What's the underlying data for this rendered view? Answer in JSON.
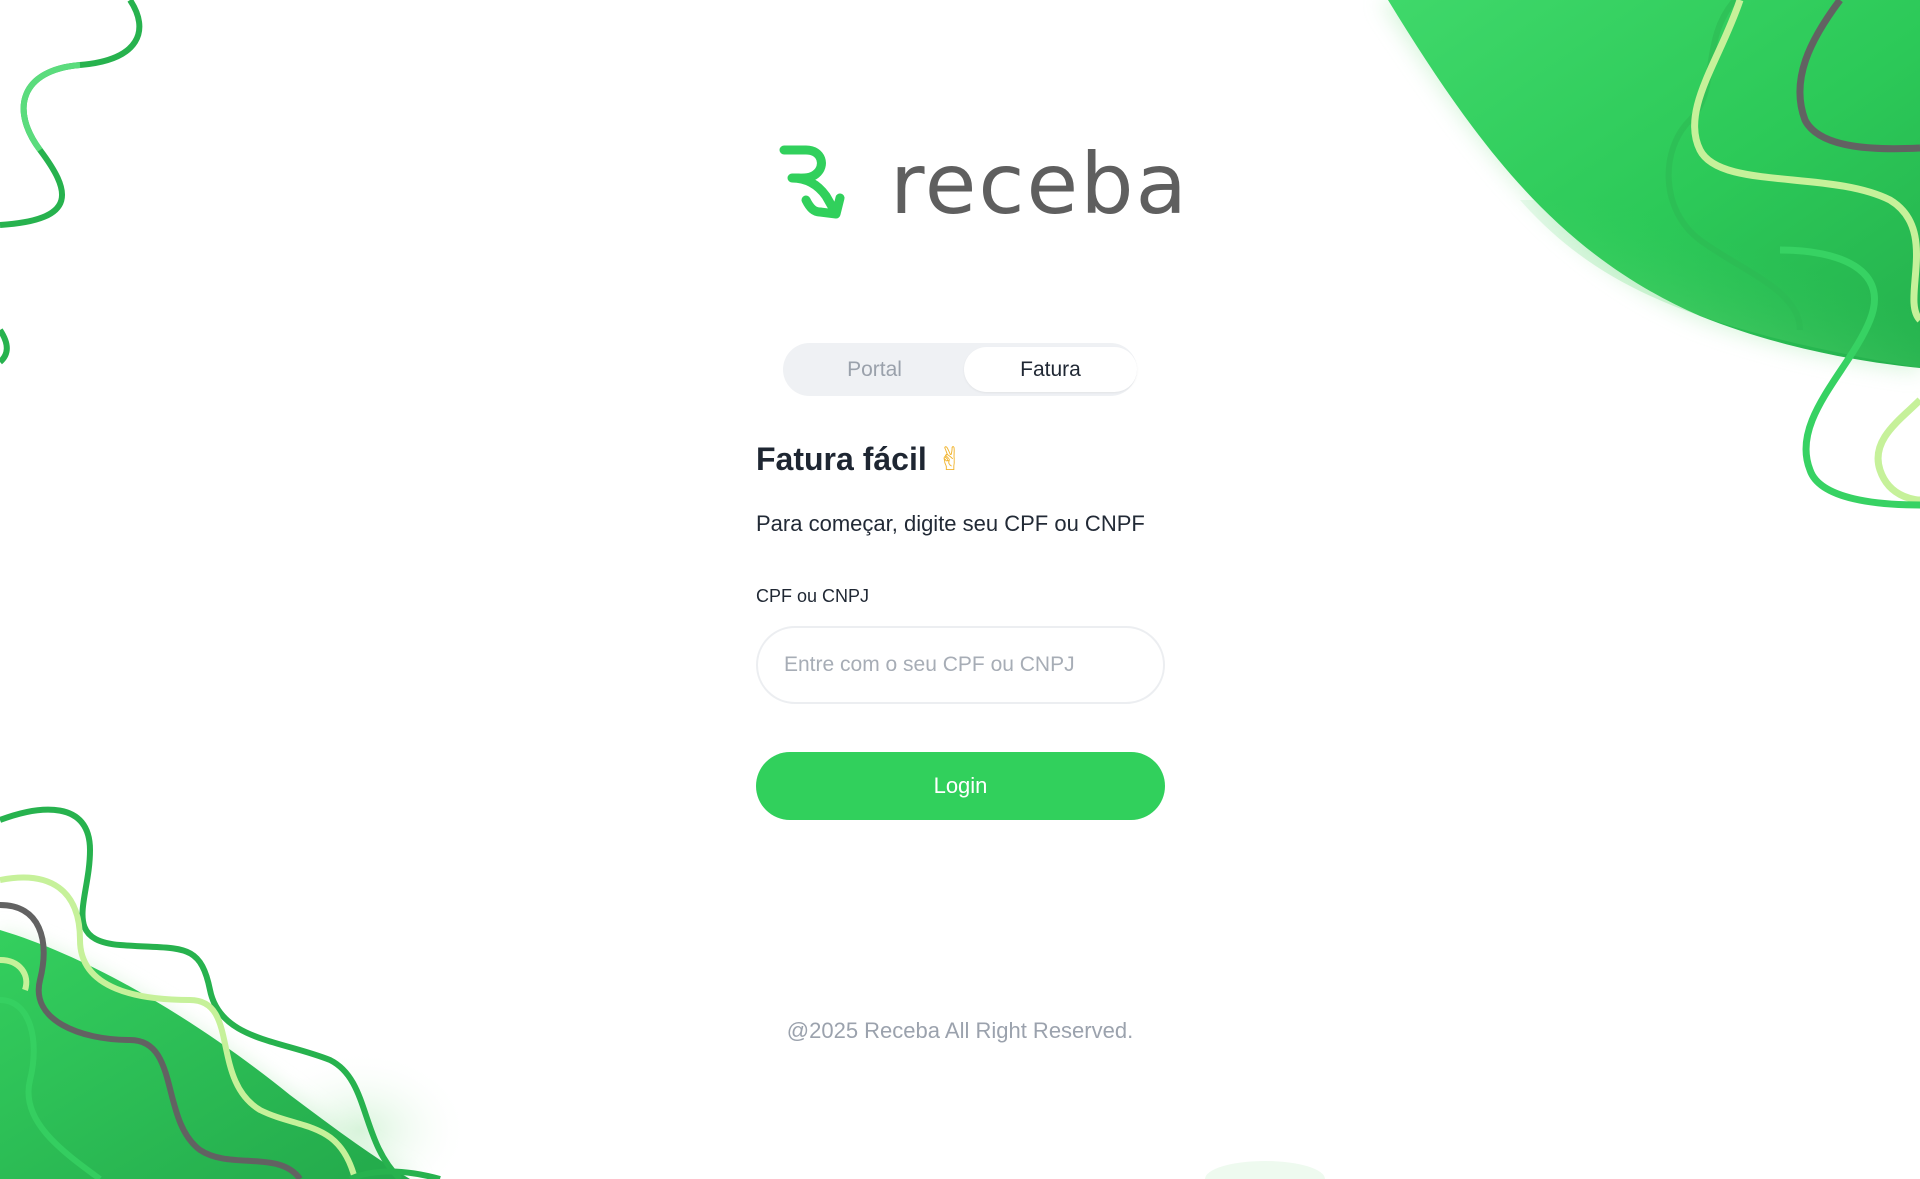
{
  "brand": {
    "name": "receba",
    "logo_icon": "arrow-r-icon",
    "colors": {
      "accent": "#31d05c",
      "wordmark": "#5f5f5f",
      "light_green": "#c6f19a",
      "dark_green": "#1ea34a",
      "gray_line": "#626262"
    }
  },
  "tabs": [
    {
      "label": "Portal",
      "active": false
    },
    {
      "label": "Fatura",
      "active": true
    }
  ],
  "form": {
    "title": "Fatura fácil",
    "title_emoji": "✌",
    "subtitle": "Para começar, digite seu CPF ou CNPF",
    "field_label": "CPF ou CNPJ",
    "field_placeholder": "Entre com o seu CPF ou CNPJ",
    "field_value": "",
    "submit_label": "Login"
  },
  "footer": {
    "text": "@2025 Receba All Right Reserved."
  }
}
